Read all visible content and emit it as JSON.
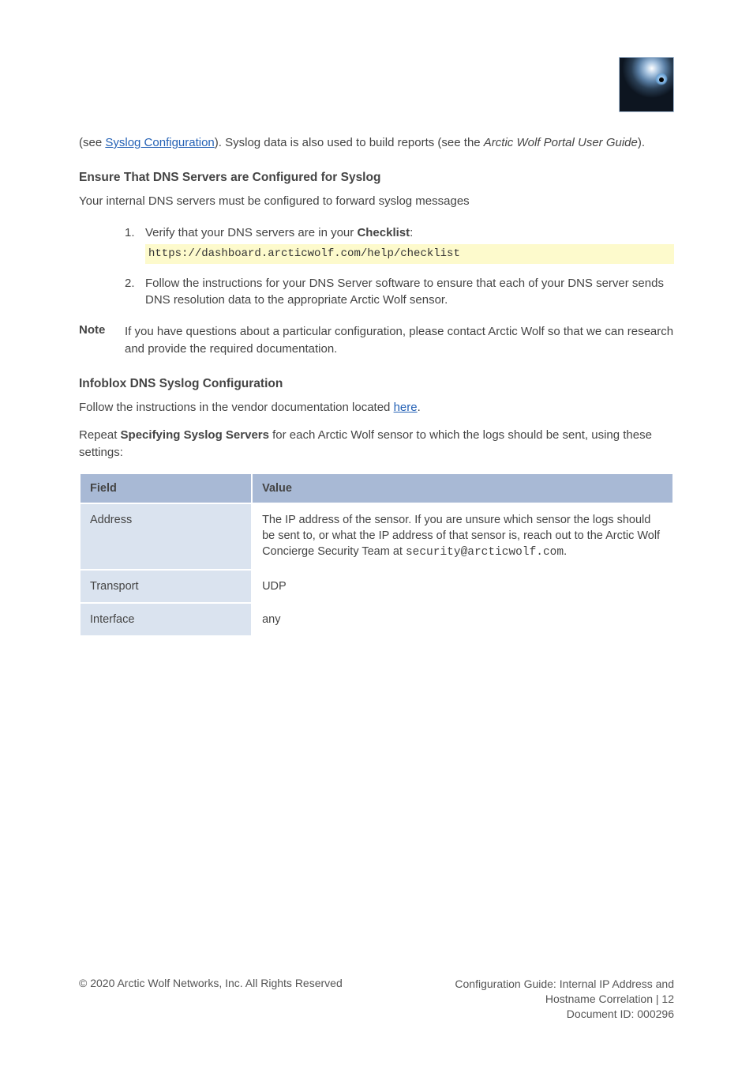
{
  "intro": {
    "p1a": "(see ",
    "link": "Syslog Configuration",
    "p1b": "). Syslog data is also used to build reports (see the ",
    "em1": "Arctic Wolf Portal User Guide",
    "p1c": ")."
  },
  "section1": {
    "heading": "Ensure That DNS Servers are Configured for Syslog",
    "intro": "Your internal DNS servers must be configured to forward syslog messages",
    "steps": {
      "s1_pre": "Verify that your DNS servers are in your ",
      "s1_bold": "Checklist",
      "s1_post": ":",
      "code1": "https://dashboard.arcticwolf.com/help/checklist",
      "s2": "Follow the instructions for your DNS Server software to ensure that each of your DNS server sends DNS resolution data to the appropriate Arctic Wolf sensor."
    },
    "note_label": "Note",
    "note_text": "If you have questions about a particular configuration, please contact Arctic Wolf so that we can research and provide the required documentation."
  },
  "section2": {
    "heading": "Infoblox DNS Syslog Configuration",
    "p1_pre": "Follow the instructions in the vendor documentation located ",
    "p1_link": "here",
    "p1_post": ".",
    "p2_pre": "Repeat ",
    "p2_bold": "Specifying Syslog Servers",
    "p2_post": " for each Arctic Wolf sensor to which the logs should be sent, using these settings:",
    "table": {
      "headers": [
        "Field",
        "Value"
      ],
      "rows": [
        {
          "field": "Address",
          "value": "The IP address of the sensor. If you are unsure which sensor the logs should be sent to, or what the IP address of that sensor is, reach out to the Arctic Wolf Concierge Security Team at <span class=\"mono\">security@arcticwolf.com</span>."
        },
        {
          "field": "Transport",
          "value": "UDP"
        },
        {
          "field": "Interface",
          "value": "any"
        }
      ]
    }
  },
  "footer": {
    "left": "© 2020 Arctic Wolf Networks, Inc. All Rights Reserved",
    "right1": "Configuration Guide: Internal IP Address and",
    "right2": "Hostname Correlation | 12",
    "right3": "Document ID: 000296"
  }
}
